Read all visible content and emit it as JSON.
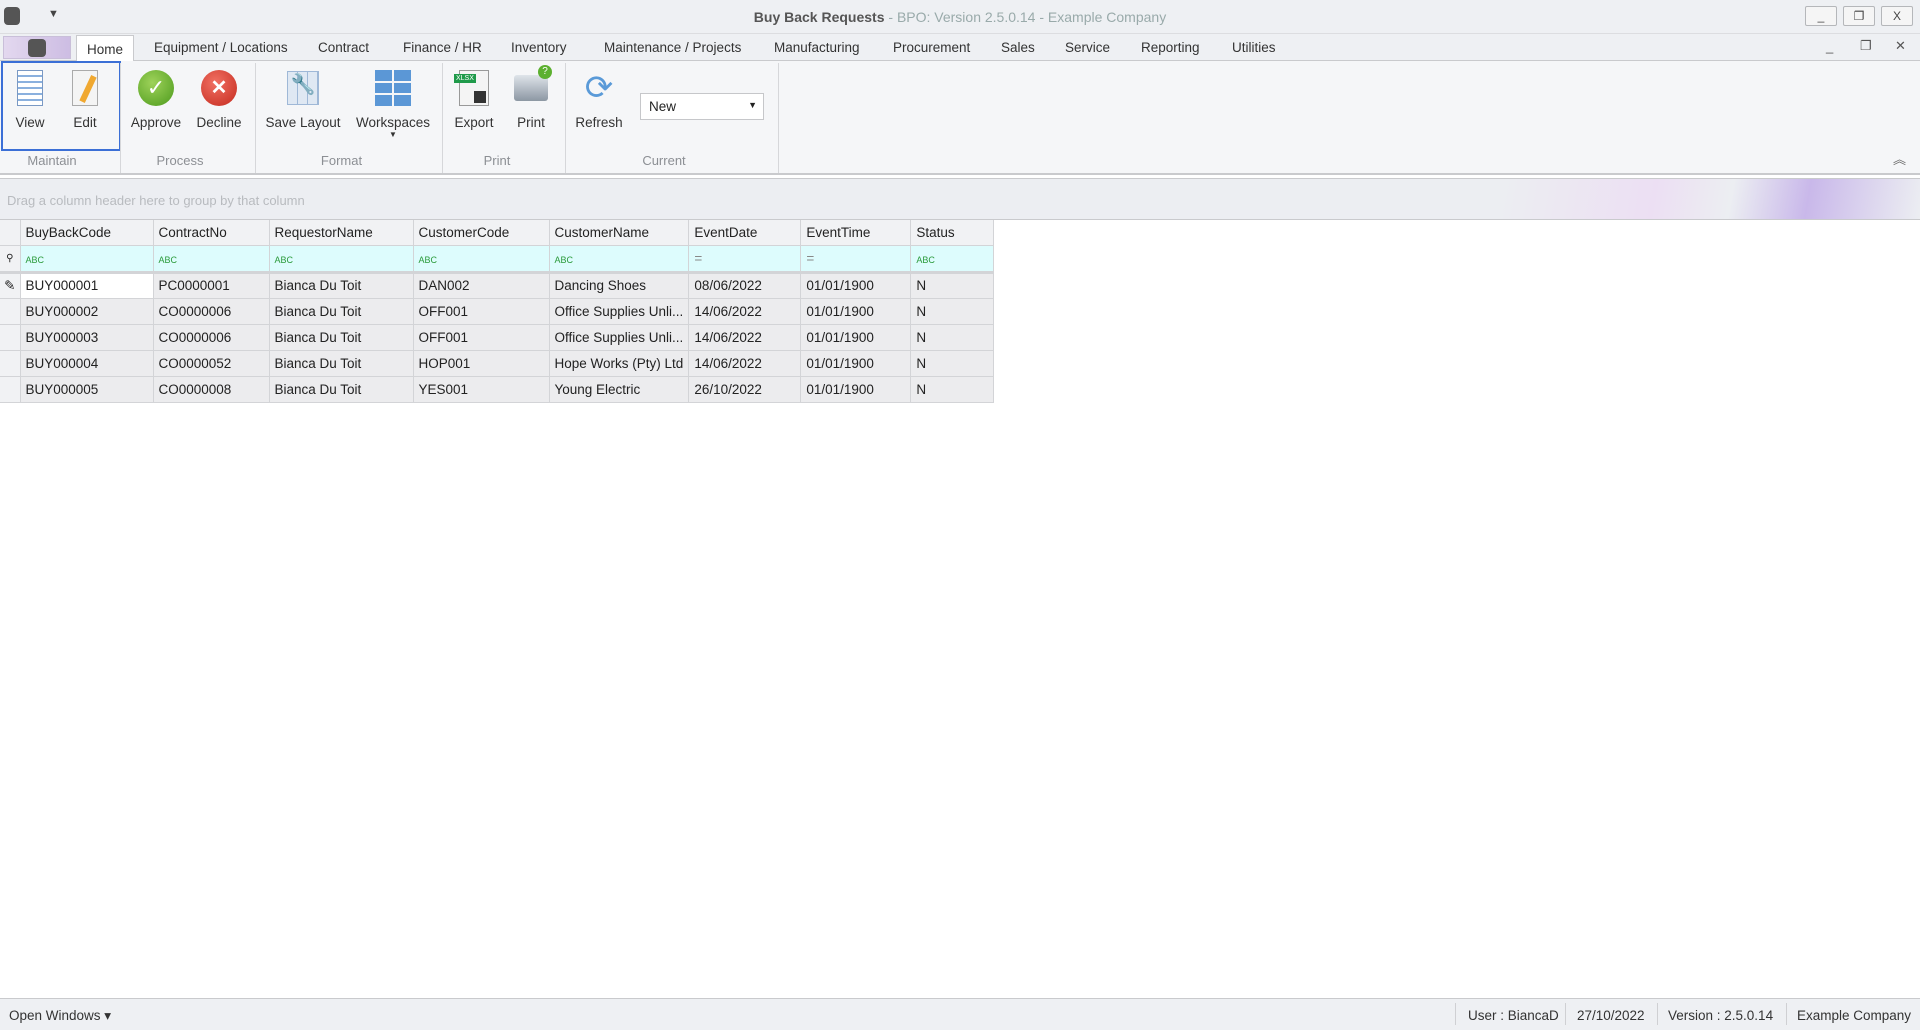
{
  "window": {
    "title": "Buy Back Requests",
    "subtitle": " - BPO: Version 2.5.0.14 - Example Company",
    "minimize": "_",
    "restore": "❐",
    "close": "X"
  },
  "tabs": [
    "Home",
    "Equipment / Locations",
    "Contract",
    "Finance / HR",
    "Inventory",
    "Maintenance / Projects",
    "Manufacturing",
    "Procurement",
    "Sales",
    "Service",
    "Reporting",
    "Utilities"
  ],
  "ribbon": {
    "buttons": {
      "view": "View",
      "edit": "Edit",
      "approve": "Approve",
      "decline": "Decline",
      "save_layout": "Save Layout",
      "workspaces": "Workspaces",
      "export": "Export",
      "print": "Print",
      "refresh": "Refresh"
    },
    "groups": {
      "maintain": "Maintain",
      "process": "Process",
      "format": "Format",
      "print": "Print",
      "current": "Current"
    },
    "current_select": "New"
  },
  "grid": {
    "group_hint": "Drag a column header here to group by that column",
    "columns": [
      "BuyBackCode",
      "ContractNo",
      "RequestorName",
      "CustomerCode",
      "CustomerName",
      "EventDate",
      "EventTime",
      "Status"
    ],
    "filter_icons": [
      "ABC",
      "ABC",
      "ABC",
      "ABC",
      "ABC",
      "=",
      "=",
      "ABC"
    ],
    "rows": [
      [
        "BUY000001",
        "PC0000001",
        "Bianca Du Toit",
        "DAN002",
        "Dancing Shoes",
        "08/06/2022",
        "01/01/1900",
        "N"
      ],
      [
        "BUY000002",
        "CO0000006",
        "Bianca Du Toit",
        "OFF001",
        "Office Supplies Unli...",
        "14/06/2022",
        "01/01/1900",
        "N"
      ],
      [
        "BUY000003",
        "CO0000006",
        "Bianca Du Toit",
        "OFF001",
        "Office Supplies Unli...",
        "14/06/2022",
        "01/01/1900",
        "N"
      ],
      [
        "BUY000004",
        "CO0000052",
        "Bianca Du Toit",
        "HOP001",
        "Hope Works (Pty) Ltd",
        "14/06/2022",
        "01/01/1900",
        "N"
      ],
      [
        "BUY000005",
        "CO0000008",
        "Bianca Du Toit",
        "YES001",
        "Young Electric",
        "26/10/2022",
        "01/01/1900",
        "N"
      ]
    ]
  },
  "status": {
    "open_windows": "Open Windows ▾",
    "user": "User : BiancaD",
    "date": "27/10/2022",
    "version": "Version : 2.5.0.14",
    "company": "Example Company"
  }
}
